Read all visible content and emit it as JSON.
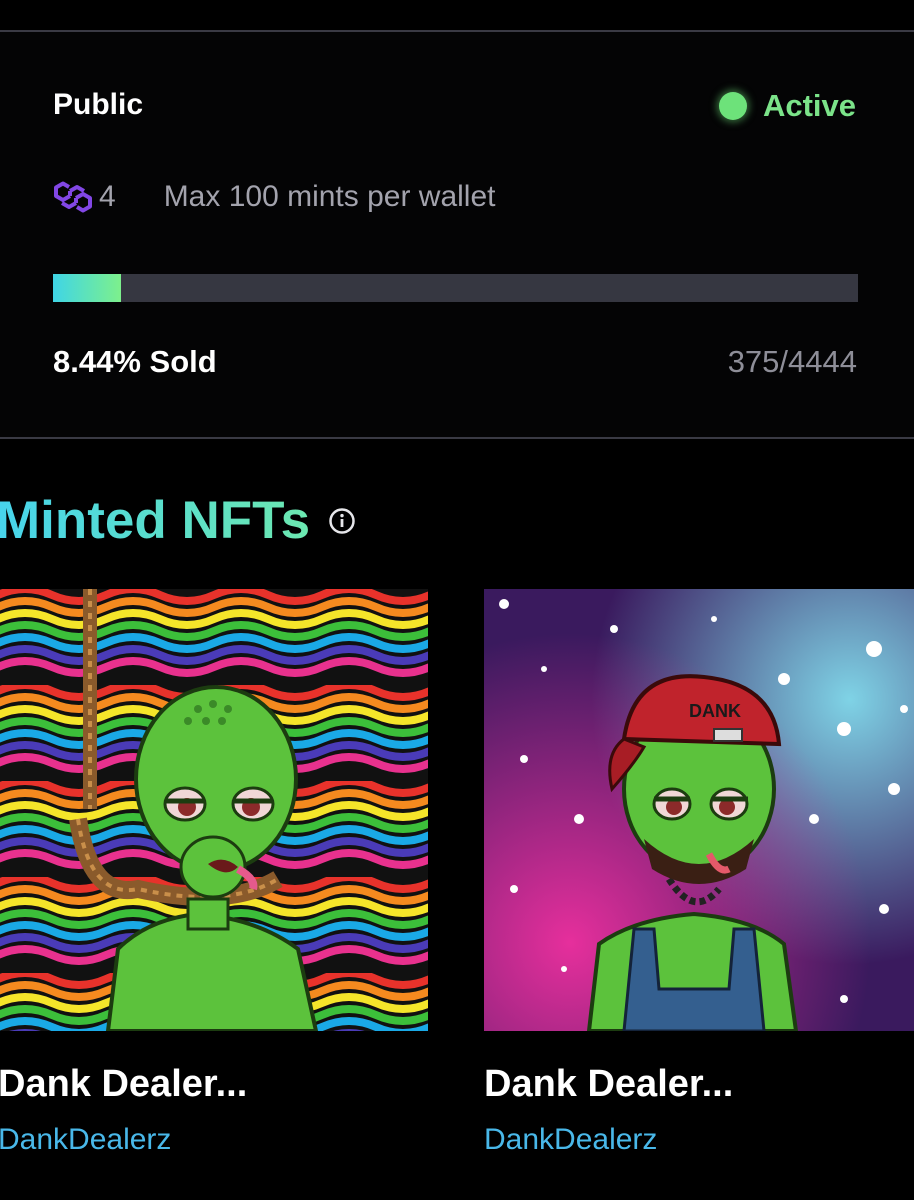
{
  "phase": {
    "title": "Public",
    "status": "Active",
    "status_color": "#7be389",
    "chain_icon": "polygon-icon",
    "price": "4",
    "mint_limit": "Max 100 mints per wallet",
    "progress_fraction": 0.0844,
    "sold_percent_label": "8.44% Sold",
    "sold_count": "375/4444"
  },
  "minted": {
    "section_title": "Minted NFTs",
    "info_icon": "info-icon",
    "cards": [
      {
        "title": "Dank Dealer...",
        "creator": "DankDealerz"
      },
      {
        "title": "Dank Dealer...",
        "creator": "DankDealerz"
      }
    ]
  }
}
